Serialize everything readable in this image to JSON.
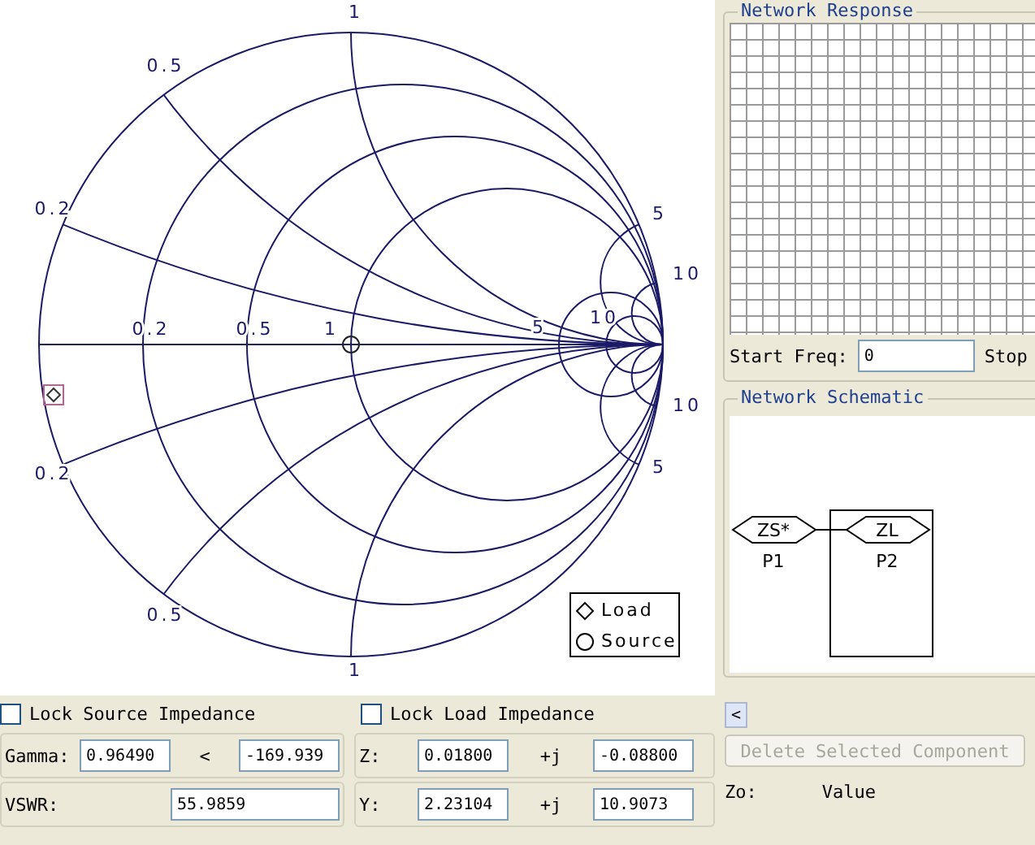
{
  "smith_chart": {
    "labels": [
      "1",
      "0.5",
      "0.2",
      "0.2",
      "0.5",
      "1",
      "5",
      "10",
      "5",
      "10",
      "10",
      "5",
      "0.2",
      "0.5",
      "1"
    ],
    "legend": [
      {
        "kind": "diamond",
        "label": "Load"
      },
      {
        "kind": "circle",
        "label": "Source"
      }
    ]
  },
  "network_response": {
    "title": "Network Response",
    "start_label": "Start Freq:",
    "start_value": "0",
    "stop_label": "Stop"
  },
  "network_schematic": {
    "title": "Network Schematic",
    "ports": [
      {
        "symbol": "ZS*",
        "label": "P1",
        "selected": false
      },
      {
        "symbol": "ZL",
        "label": "P2",
        "selected": true
      }
    ]
  },
  "locks": [
    {
      "label": "Lock Source Impedance",
      "checked": false
    },
    {
      "label": "Lock Load Impedance",
      "checked": false
    }
  ],
  "gamma": {
    "label": "Gamma:",
    "magnitude": "0.96490",
    "angle_sign": "<",
    "angle": "-169.939"
  },
  "vswr": {
    "label": "VSWR:",
    "value": "55.9859"
  },
  "z": {
    "label": "Z:",
    "real": "0.01800",
    "j": "+j",
    "imag": "-0.08800"
  },
  "y": {
    "label": "Y:",
    "real": "2.23104",
    "j": "+j",
    "imag": "10.9073"
  },
  "side": {
    "scroll": "<",
    "delete_button": {
      "label": "Delete Selected Component",
      "disabled": true
    },
    "zo_label": "Zo:",
    "value_label": "Value"
  }
}
